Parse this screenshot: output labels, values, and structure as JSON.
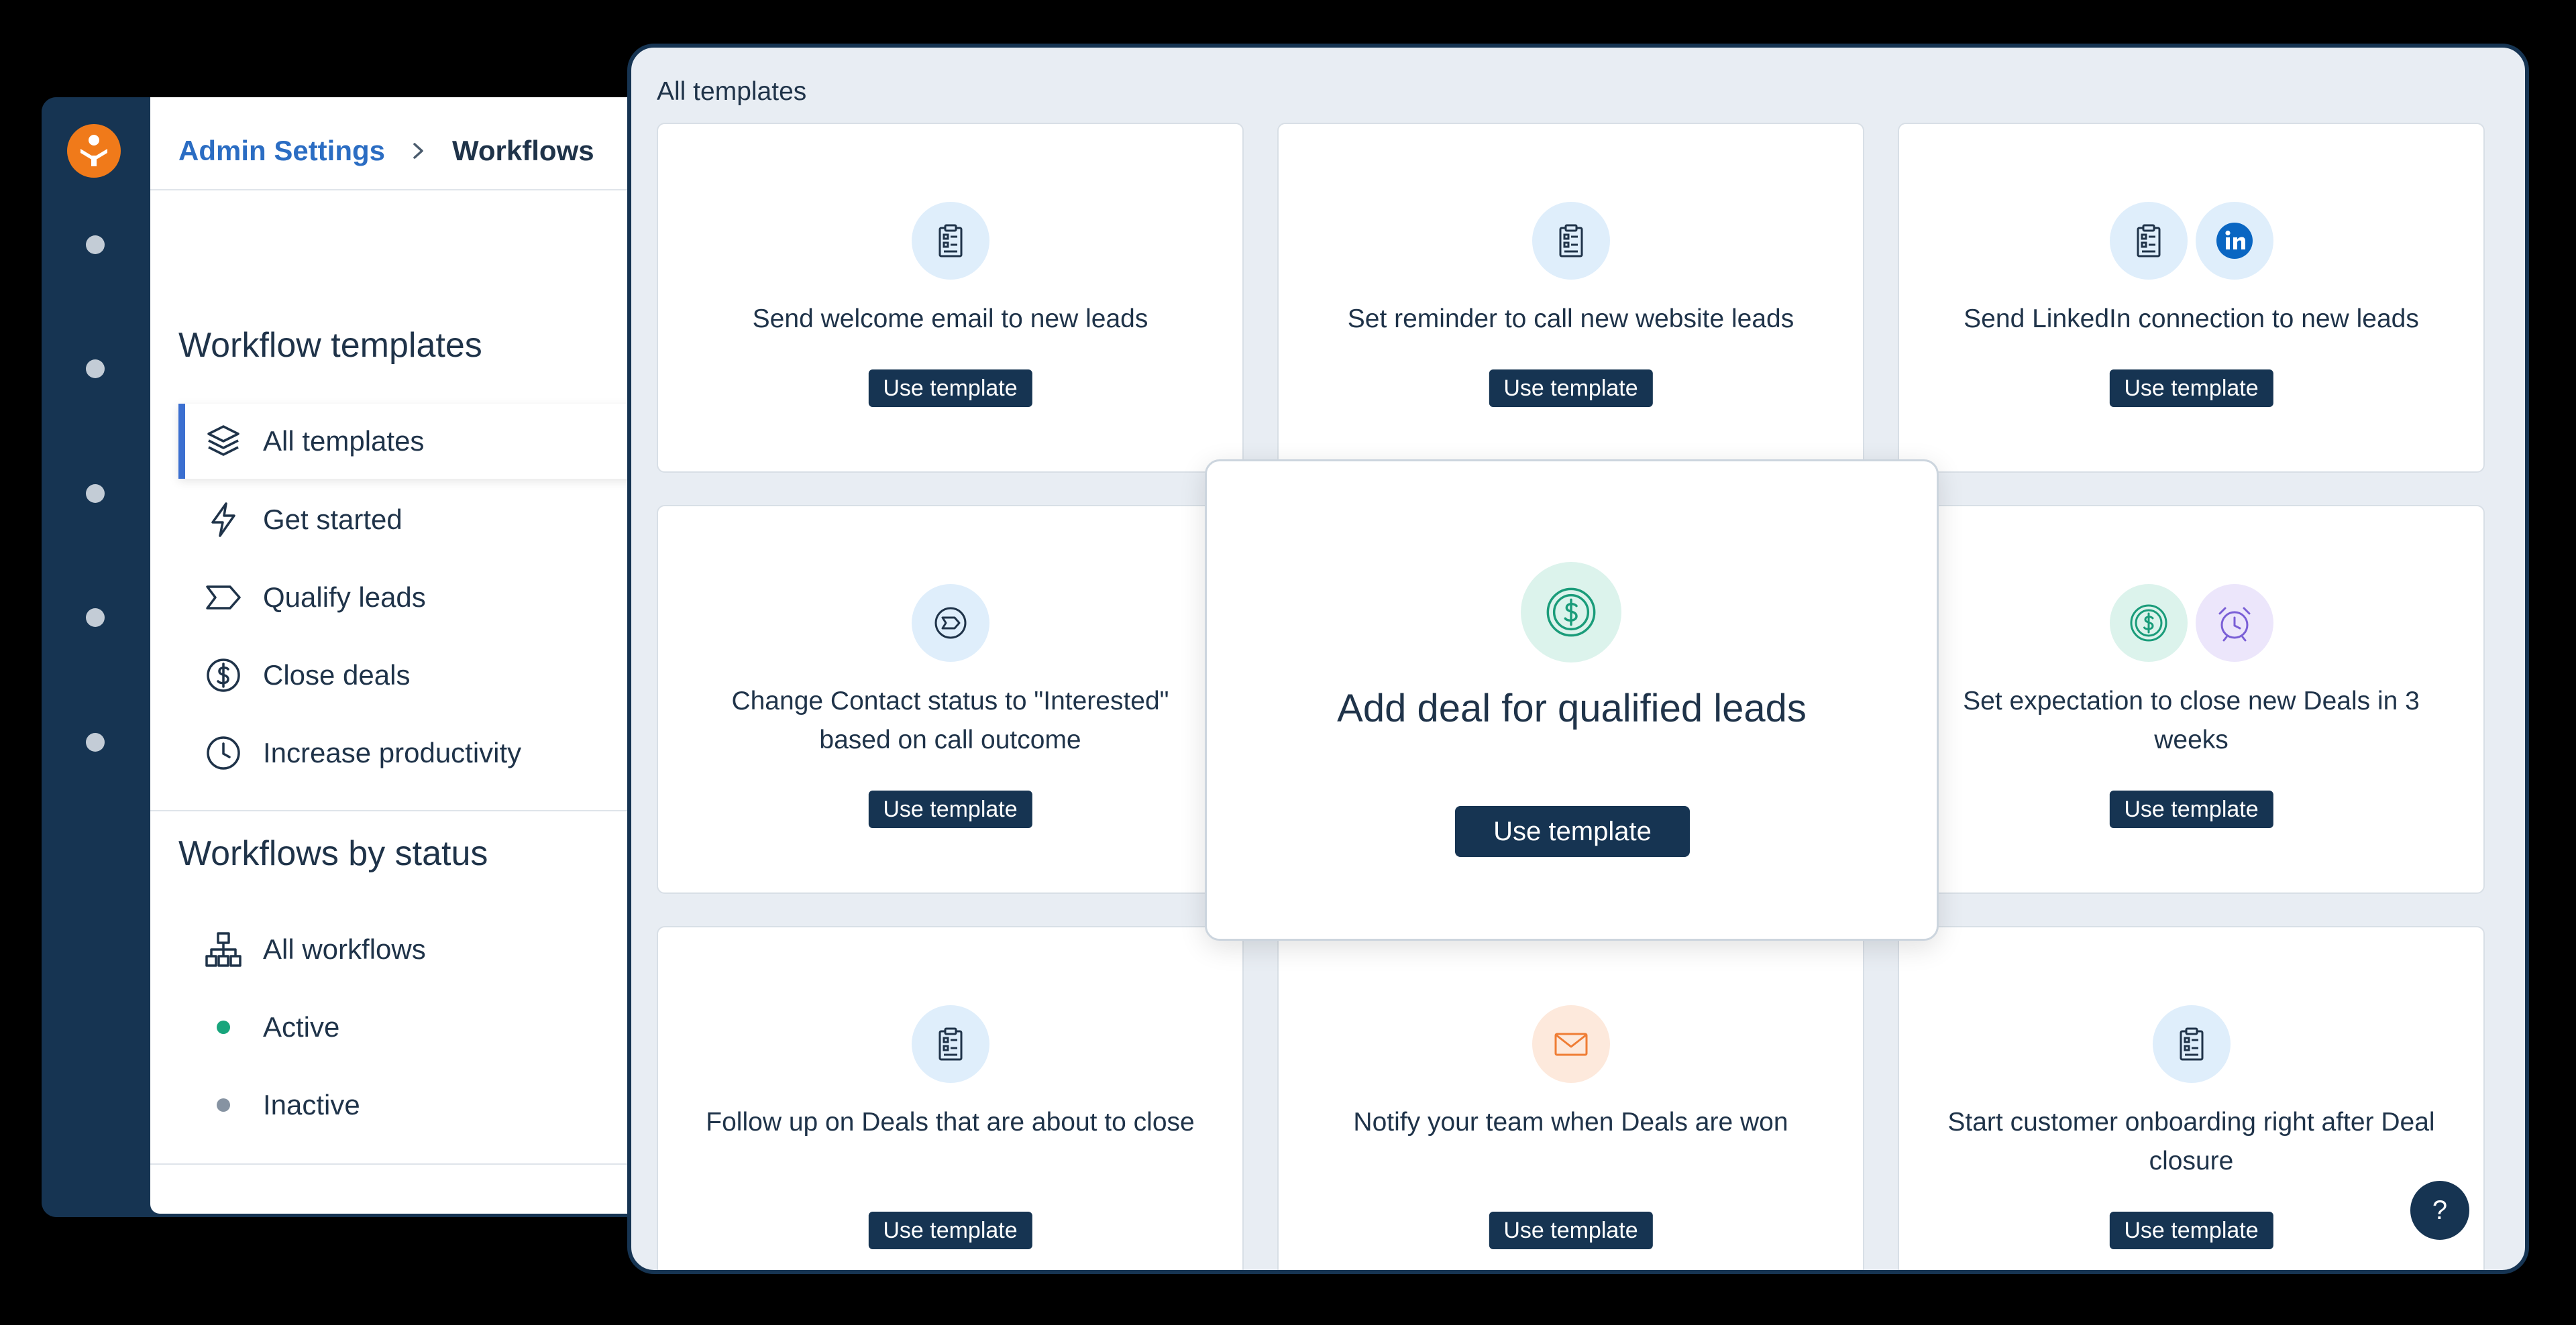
{
  "colors": {
    "navy": "#163452",
    "accent_blue": "#3b6fd0",
    "brand_orange": "#f07a1a",
    "active_green": "#18a57c",
    "inactive_gray": "#8693a2"
  },
  "breadcrumb": {
    "parent": "Admin Settings",
    "separator_icon": "chevron-right-icon",
    "current": "Workflows"
  },
  "sidebar": {
    "templates_title": "Workflow templates",
    "templates": [
      {
        "label": "All templates",
        "icon": "layers-icon",
        "active": true
      },
      {
        "label": "Get started",
        "icon": "lightning-icon",
        "active": false
      },
      {
        "label": "Qualify leads",
        "icon": "funnel-step-icon",
        "active": false
      },
      {
        "label": "Close deals",
        "icon": "dollar-icon",
        "active": false
      },
      {
        "label": "Increase productivity",
        "icon": "clock-icon",
        "active": false
      }
    ],
    "status_title": "Workflows by status",
    "statuses": [
      {
        "label": "All workflows",
        "icon": "hierarchy-icon"
      },
      {
        "label": "Active",
        "icon": "green-dot-icon"
      },
      {
        "label": "Inactive",
        "icon": "gray-dot-icon"
      }
    ]
  },
  "main": {
    "section_label": "All templates",
    "button_label": "Use template",
    "cards": [
      {
        "title": "Send welcome email to new leads",
        "icons": [
          "clipboard-icon"
        ]
      },
      {
        "title": "Set reminder to call new website leads",
        "icons": [
          "clipboard-icon"
        ]
      },
      {
        "title": "Send LinkedIn connection to new leads",
        "icons": [
          "clipboard-icon",
          "linkedin-icon"
        ]
      },
      {
        "title": "Change Contact status to \"Interested\" based on call outcome",
        "icons": [
          "status-step-icon"
        ]
      },
      {
        "title": "Set expectation to close new Deals in 3 weeks",
        "icons": [
          "dollar-icon",
          "alarm-clock-icon"
        ]
      },
      {
        "title": "Follow up on Deals that are about to close",
        "icons": [
          "clipboard-icon"
        ]
      },
      {
        "title": "Notify your team when Deals are won",
        "icons": [
          "envelope-icon"
        ]
      },
      {
        "title": "Start customer onboarding right after Deal closure",
        "icons": [
          "clipboard-icon"
        ]
      }
    ],
    "featured": {
      "title": "Add deal for qualified leads",
      "icon": "dollar-icon",
      "button_label": "Use template"
    }
  },
  "help": {
    "label": "?"
  }
}
